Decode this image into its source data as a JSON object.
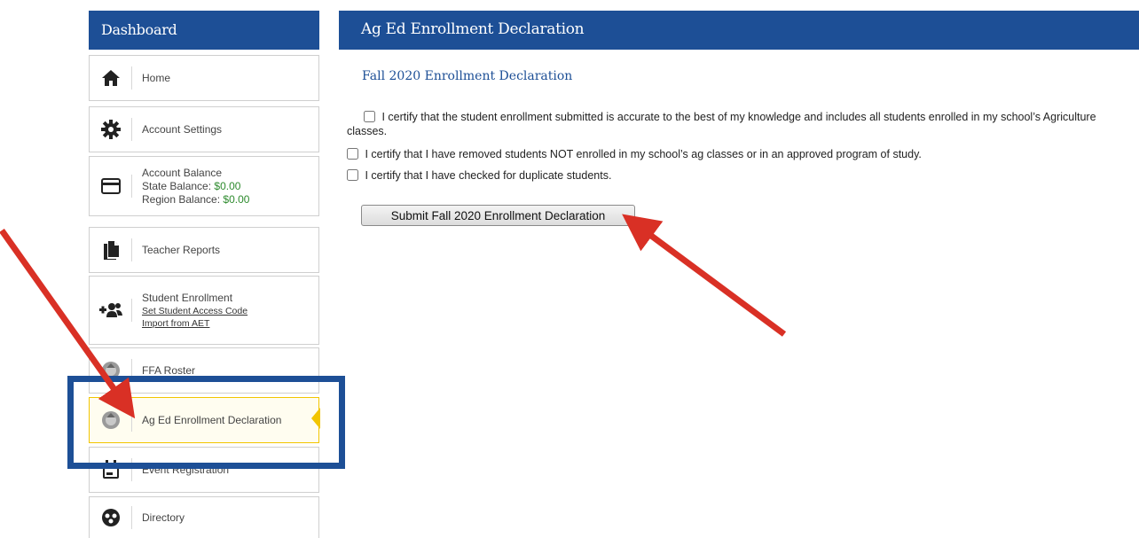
{
  "sidebar": {
    "title": "Dashboard",
    "items": [
      {
        "label": "Home",
        "icon": "home-icon"
      },
      {
        "label": "Account Settings",
        "icon": "gear-icon"
      },
      {
        "label": "Account Balance",
        "state_label": "State Balance: ",
        "state_value": "$0.00",
        "region_label": "Region Balance: ",
        "region_value": "$0.00",
        "icon": "credit-card-icon"
      },
      {
        "label": "Teacher Reports",
        "icon": "documents-icon"
      },
      {
        "label": "Student Enrollment",
        "link1": "Set Student Access Code",
        "link2": "Import from AET",
        "icon": "add-users-icon"
      },
      {
        "label": "FFA Roster",
        "icon": "ffa-emblem-icon"
      },
      {
        "label": "Ag Ed Enrollment Declaration",
        "icon": "ffa-emblem-icon"
      },
      {
        "label": "Event Registration",
        "icon": "calendar-icon"
      },
      {
        "label": "Directory",
        "icon": "directory-icon"
      }
    ]
  },
  "main": {
    "title": "Ag Ed Enrollment Declaration",
    "section_title": "Fall 2020 Enrollment Declaration",
    "certifications": [
      {
        "text": "I certify that the student enrollment submitted is accurate to the best of my knowledge and includes all students enrolled in my school’s Agriculture classes.",
        "checked": false
      },
      {
        "text": "I certify that I have removed students NOT enrolled in my school’s ag classes or in an approved program of study.",
        "checked": false
      },
      {
        "text": "I certify that I have checked for duplicate students.",
        "checked": false
      }
    ],
    "submit_label": "Submit Fall 2020 Enrollment Declaration"
  },
  "colors": {
    "brand_blue": "#1d4f96",
    "active_yellow": "#f2c500",
    "balance_green": "#2e8b2e",
    "annotation_red": "#d93025"
  }
}
